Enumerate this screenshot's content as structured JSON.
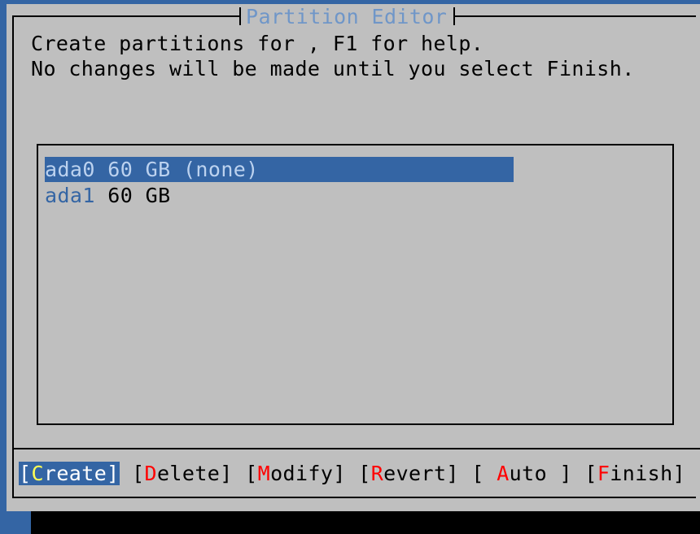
{
  "dialog": {
    "title": "Partition Editor",
    "prompt_line1": "Create partitions for , F1 for help.",
    "prompt_line2": "No changes will be made until you select Finish."
  },
  "disks": [
    {
      "device": "ada0",
      "info": "60 GB (none)",
      "selected": true
    },
    {
      "device": "ada1",
      "info": "60 GB",
      "selected": false
    }
  ],
  "buttons": {
    "create": {
      "open": "[",
      "hotkey": "C",
      "rest": "reate",
      "close": "]"
    },
    "delete": {
      "open": "[",
      "hotkey": "D",
      "rest": "elete",
      "close": "]"
    },
    "modify": {
      "open": "[",
      "hotkey": "M",
      "rest": "odify",
      "close": "]"
    },
    "revert": {
      "open": "[",
      "hotkey": "R",
      "rest": "evert",
      "close": "]"
    },
    "auto": {
      "open": "[ ",
      "hotkey": "A",
      "rest": "uto",
      "close": " ]"
    },
    "finish": {
      "open": "[",
      "hotkey": "F",
      "rest": "inish",
      "close": "]"
    }
  },
  "colors": {
    "background": "#3465a4",
    "dialog": "#bfbfbf",
    "title_text": "#6f96c8",
    "hotkey": "#ff0000",
    "focused_hotkey": "#ffff55",
    "selection": "#3465a4"
  }
}
